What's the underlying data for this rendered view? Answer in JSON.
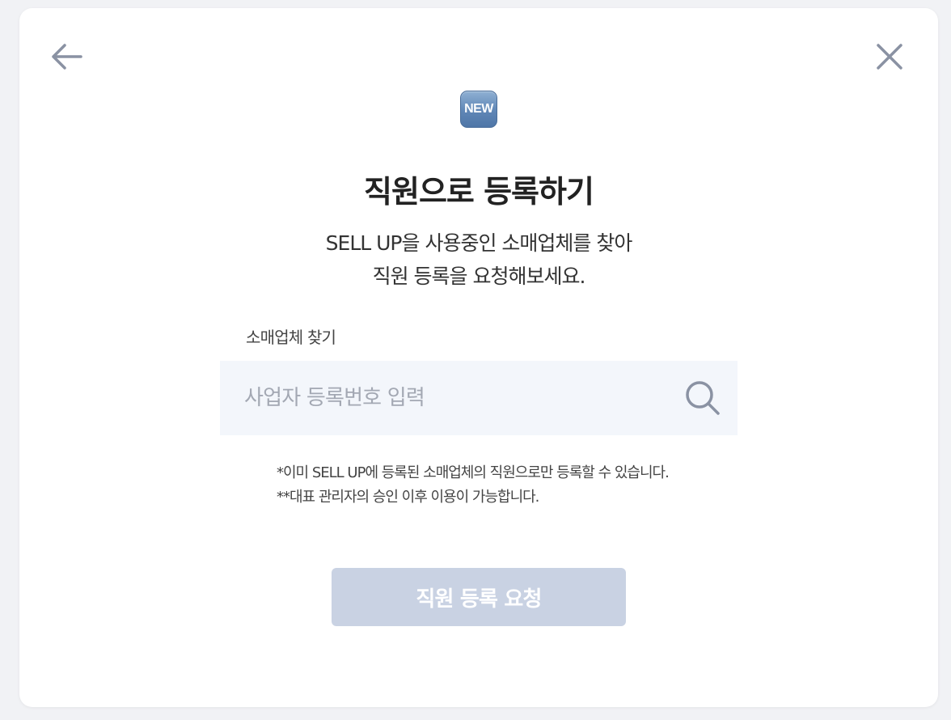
{
  "badge": {
    "text": "NEW",
    "icon": "new-badge-icon"
  },
  "header": {
    "back_icon": "arrow-left-icon",
    "close_icon": "close-icon",
    "icon_color": "#8a92a3"
  },
  "title": "직원으로 등록하기",
  "subtitle": {
    "line1": "SELL UP을 사용중인 소매업체를 찾아",
    "line2": "직원 등록을 요청해보세요."
  },
  "search": {
    "label": "소매업체 찾기",
    "placeholder": "사업자 등록번호 입력",
    "value": "",
    "icon": "search-icon"
  },
  "notes": {
    "line1": "*이미 SELL UP에 등록된 소매업체의 직원으로만 등록할 수 있습니다.",
    "line2": "**대표 관리자의 승인 이후 이용이 가능합니다."
  },
  "submit": {
    "label": "직원 등록 요청",
    "disabled": true,
    "color": "#c9d2e3"
  }
}
